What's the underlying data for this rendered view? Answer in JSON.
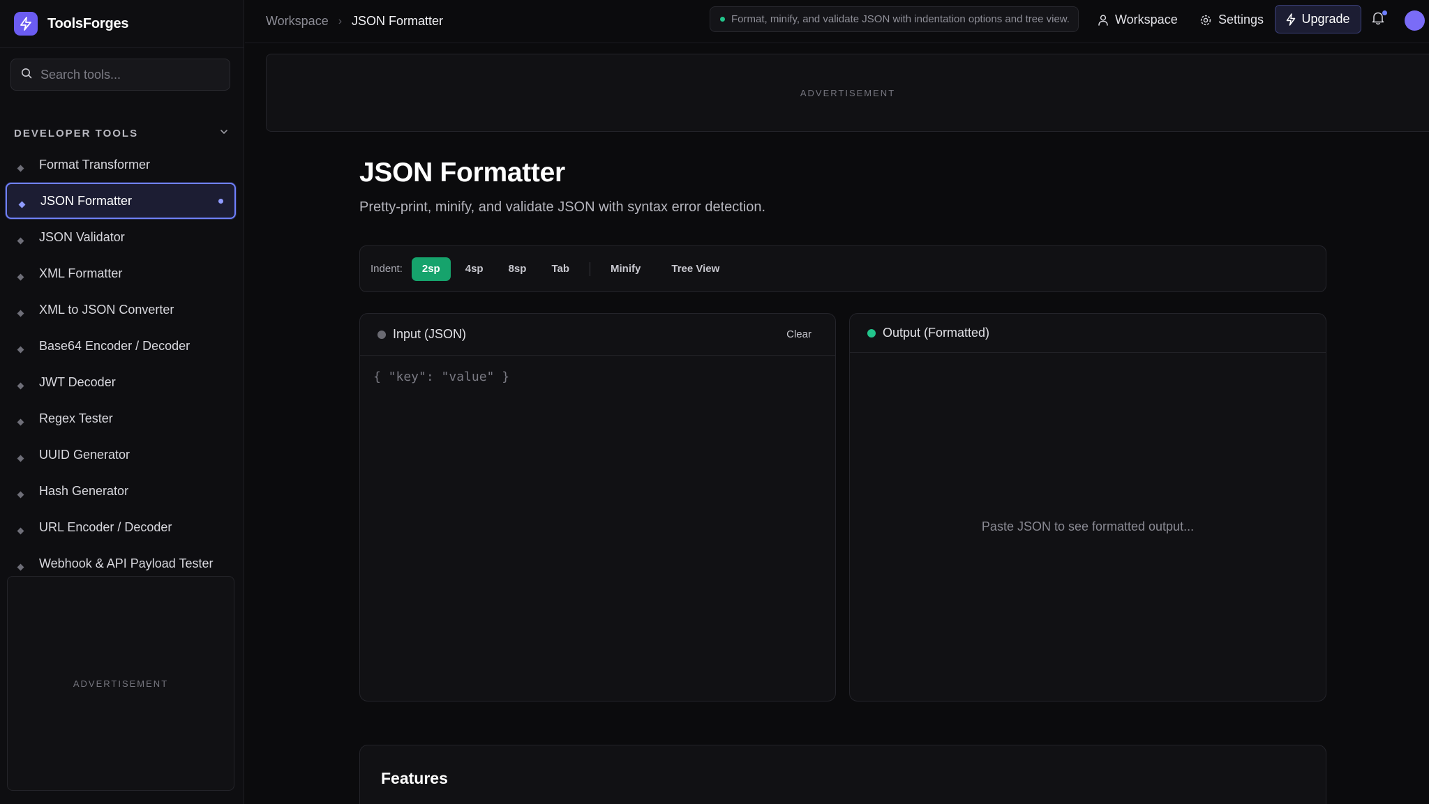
{
  "brand": {
    "name": "ToolsForges"
  },
  "search": {
    "placeholder": "Search tools..."
  },
  "sidebar": {
    "section_title": "DEVELOPER TOOLS",
    "items": [
      {
        "label": "Format Transformer"
      },
      {
        "label": "JSON Formatter",
        "active": true
      },
      {
        "label": "JSON Validator"
      },
      {
        "label": "XML Formatter"
      },
      {
        "label": "XML to JSON Converter"
      },
      {
        "label": "Base64 Encoder / Decoder"
      },
      {
        "label": "JWT Decoder"
      },
      {
        "label": "Regex Tester"
      },
      {
        "label": "UUID Generator"
      },
      {
        "label": "Hash Generator"
      },
      {
        "label": "URL Encoder / Decoder"
      },
      {
        "label": "Webhook & API Payload Tester"
      }
    ],
    "ad_label": "ADVERTISEMENT"
  },
  "topbar": {
    "breadcrumb_root": "Workspace",
    "breadcrumb_current": "JSON Formatter",
    "info": "Format, minify, and validate JSON with indentation options and tree view.",
    "workspace_label": "Workspace",
    "settings_label": "Settings",
    "upgrade_label": "Upgrade"
  },
  "main": {
    "ad_label": "ADVERTISEMENT",
    "title": "JSON Formatter",
    "subtitle": "Pretty-print, minify, and validate JSON with syntax error detection.",
    "toolbar": {
      "indent_label": "Indent:",
      "indent_options": [
        "2sp",
        "4sp",
        "8sp",
        "Tab"
      ],
      "selected": "2sp",
      "minify_label": "Minify",
      "tree_label": "Tree View"
    },
    "input_panel": {
      "title": "Input (JSON)",
      "clear_label": "Clear",
      "placeholder": "{ \"key\": \"value\" }"
    },
    "output_panel": {
      "title": "Output (Formatted)",
      "placeholder": "Paste JSON to see formatted output..."
    },
    "features_title": "Features"
  },
  "colors": {
    "accent": "#6f80ff",
    "brand": "#6b5cf2",
    "success": "#22c58b",
    "active_indent": "#16a36c"
  }
}
